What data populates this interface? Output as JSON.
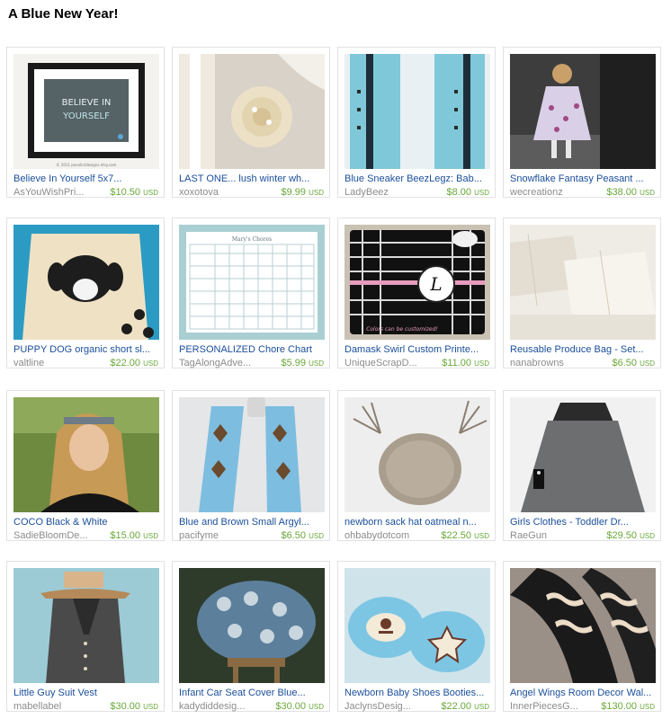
{
  "page": {
    "title": "A Blue New Year!"
  },
  "currency_label": "USD",
  "items": [
    {
      "name": "Believe In Yourself 5x7...",
      "shop": "AsYouWishPri...",
      "price": "$10.50",
      "art_text_1": "BELIEVE IN",
      "art_text_2": "YOURSELF",
      "art_text_3": "© 2011 pevolictdesigns.etsy.com"
    },
    {
      "name": "LAST ONE... lush winter wh...",
      "shop": "xoxotova",
      "price": "$9.99"
    },
    {
      "name": "Blue Sneaker BeezLegz: Bab...",
      "shop": "LadyBeez",
      "price": "$8.00"
    },
    {
      "name": "Snowflake Fantasy Peasant ...",
      "shop": "wecreationz",
      "price": "$38.00"
    },
    {
      "name": "PUPPY DOG organic short sl...",
      "shop": "valtline",
      "price": "$22.00"
    },
    {
      "name": "PERSONALIZED Chore Chart",
      "shop": "TagAlongAdve...",
      "price": "$5.99",
      "art_text_1": "Mary's Chores"
    },
    {
      "name": "Damask Swirl Custom Printe...",
      "shop": "UniqueScrapD...",
      "price": "$11.00",
      "art_text_1": "L",
      "art_text_2": "Colors can be customized!"
    },
    {
      "name": "Reusable Produce Bag - Set...",
      "shop": "nanabrowns",
      "price": "$6.50"
    },
    {
      "name": "COCO Black & White",
      "shop": "SadieBloomDe...",
      "price": "$15.00"
    },
    {
      "name": "Blue and Brown Small Argyl...",
      "shop": "pacifyme",
      "price": "$6.50"
    },
    {
      "name": "newborn sack hat oatmeal n...",
      "shop": "ohbabydotcom",
      "price": "$22.50"
    },
    {
      "name": "Girls Clothes - Toddler Dr...",
      "shop": "RaeGun",
      "price": "$29.50"
    },
    {
      "name": "Little Guy Suit Vest",
      "shop": "mabellabel",
      "price": "$30.00"
    },
    {
      "name": "Infant Car Seat Cover Blue...",
      "shop": "kadydiddesig...",
      "price": "$30.00"
    },
    {
      "name": "Newborn Baby Shoes Booties...",
      "shop": "JaclynsDesig...",
      "price": "$22.00"
    },
    {
      "name": "Angel Wings Room Decor Wal...",
      "shop": "InnerPiecesG...",
      "price": "$130.00"
    }
  ]
}
